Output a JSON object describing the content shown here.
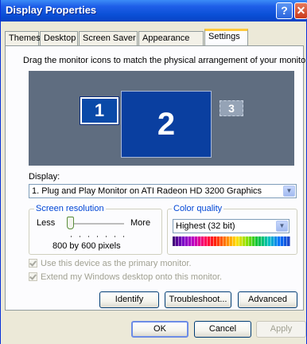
{
  "window": {
    "title": "Display Properties",
    "help_label": "?",
    "close_label": "✕"
  },
  "tabs": [
    {
      "label": "Themes"
    },
    {
      "label": "Desktop"
    },
    {
      "label": "Screen Saver"
    },
    {
      "label": "Appearance"
    },
    {
      "label": "Settings",
      "active": true
    }
  ],
  "settings": {
    "instruction": "Drag the monitor icons to match the physical arrangement of your monitors.",
    "monitors": [
      {
        "label": "1",
        "selected": false
      },
      {
        "label": "2",
        "selected": true
      },
      {
        "label": "3",
        "selected": false
      }
    ],
    "display_label": "Display:",
    "display_value": "1. Plug and Play Monitor on ATI Radeon HD 3200 Graphics",
    "resolution": {
      "title": "Screen resolution",
      "less_label": "Less",
      "more_label": "More",
      "value_text": "800 by 600 pixels",
      "slider_position": 0
    },
    "color": {
      "title": "Color quality",
      "value": "Highest (32 bit)"
    },
    "primary_checkbox": {
      "label": "Use this device as the primary monitor.",
      "checked": true,
      "enabled": false
    },
    "extend_checkbox": {
      "label": "Extend my Windows desktop onto this monitor.",
      "checked": true,
      "enabled": false
    },
    "buttons": {
      "identify": "Identify",
      "troubleshoot": "Troubleshoot...",
      "advanced": "Advanced"
    }
  },
  "dialog_buttons": {
    "ok": "OK",
    "cancel": "Cancel",
    "apply": "Apply"
  },
  "colors": {
    "titlebar": "#0a4fd6",
    "monitor_background": "#5f6d80",
    "selected_monitor": "#0a3fa0",
    "group_title": "#0046d5"
  }
}
